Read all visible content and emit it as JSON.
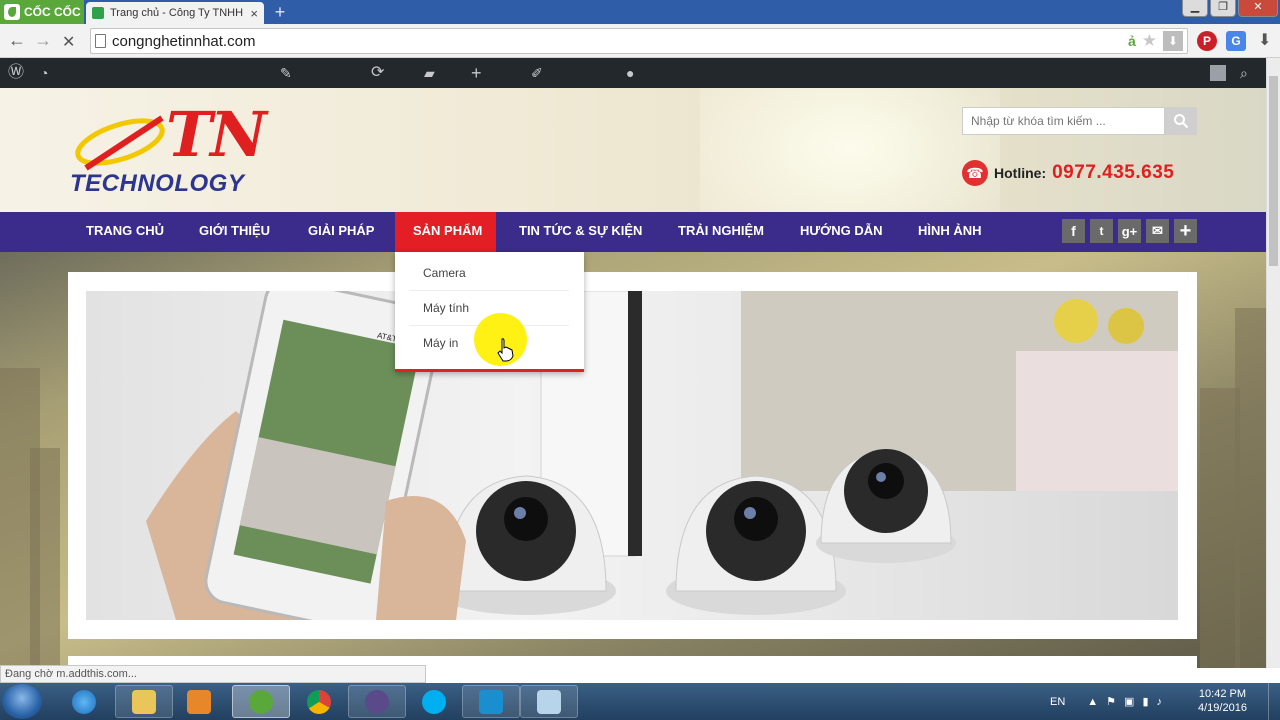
{
  "browser": {
    "brand": "CỐC CỐC",
    "tab_title": "Trang chủ - Công Ty TNHH",
    "tab_close": "×",
    "new_tab": "+",
    "url": "congnghetinnhat.com",
    "back": "←",
    "forward": "→",
    "stop": "✕"
  },
  "site": {
    "logo_main": "TN",
    "logo_sub": "TECHNOLOGY",
    "search_placeholder": "Nhập từ khóa tìm kiếm ...",
    "hotline_label": "Hotline:",
    "hotline_number": "0977.435.635",
    "nav": [
      {
        "label": "TRANG CHỦ"
      },
      {
        "label": "GIỚI THIỆU"
      },
      {
        "label": "GIẢI PHÁP"
      },
      {
        "label": "SẢN PHẨM"
      },
      {
        "label": "TIN TỨC & SỰ KIỆN"
      },
      {
        "label": "TRẢI NGHIỆM"
      },
      {
        "label": "HƯỚNG DẪN"
      },
      {
        "label": "HÌNH ẢNH"
      }
    ],
    "active_nav": "SẢN PHẨM",
    "dropdown": [
      {
        "label": "Camera"
      },
      {
        "label": "Máy tính"
      },
      {
        "label": "Máy in"
      }
    ],
    "social": {
      "facebook": "f",
      "twitter": "t",
      "gplus": "g+",
      "mail": "✉",
      "more": "+"
    },
    "phone_screen_text": "AT&T",
    "colors": {
      "nav_bg": "#3b2b8a",
      "nav_active": "#e31e24",
      "hotline": "#e02020",
      "logo_blue": "#2c3590"
    }
  },
  "status_text": "Đang chờ m.addthis.com...",
  "taskbar": {
    "lang": "EN",
    "time": "10:42 PM",
    "date": "4/19/2016"
  }
}
